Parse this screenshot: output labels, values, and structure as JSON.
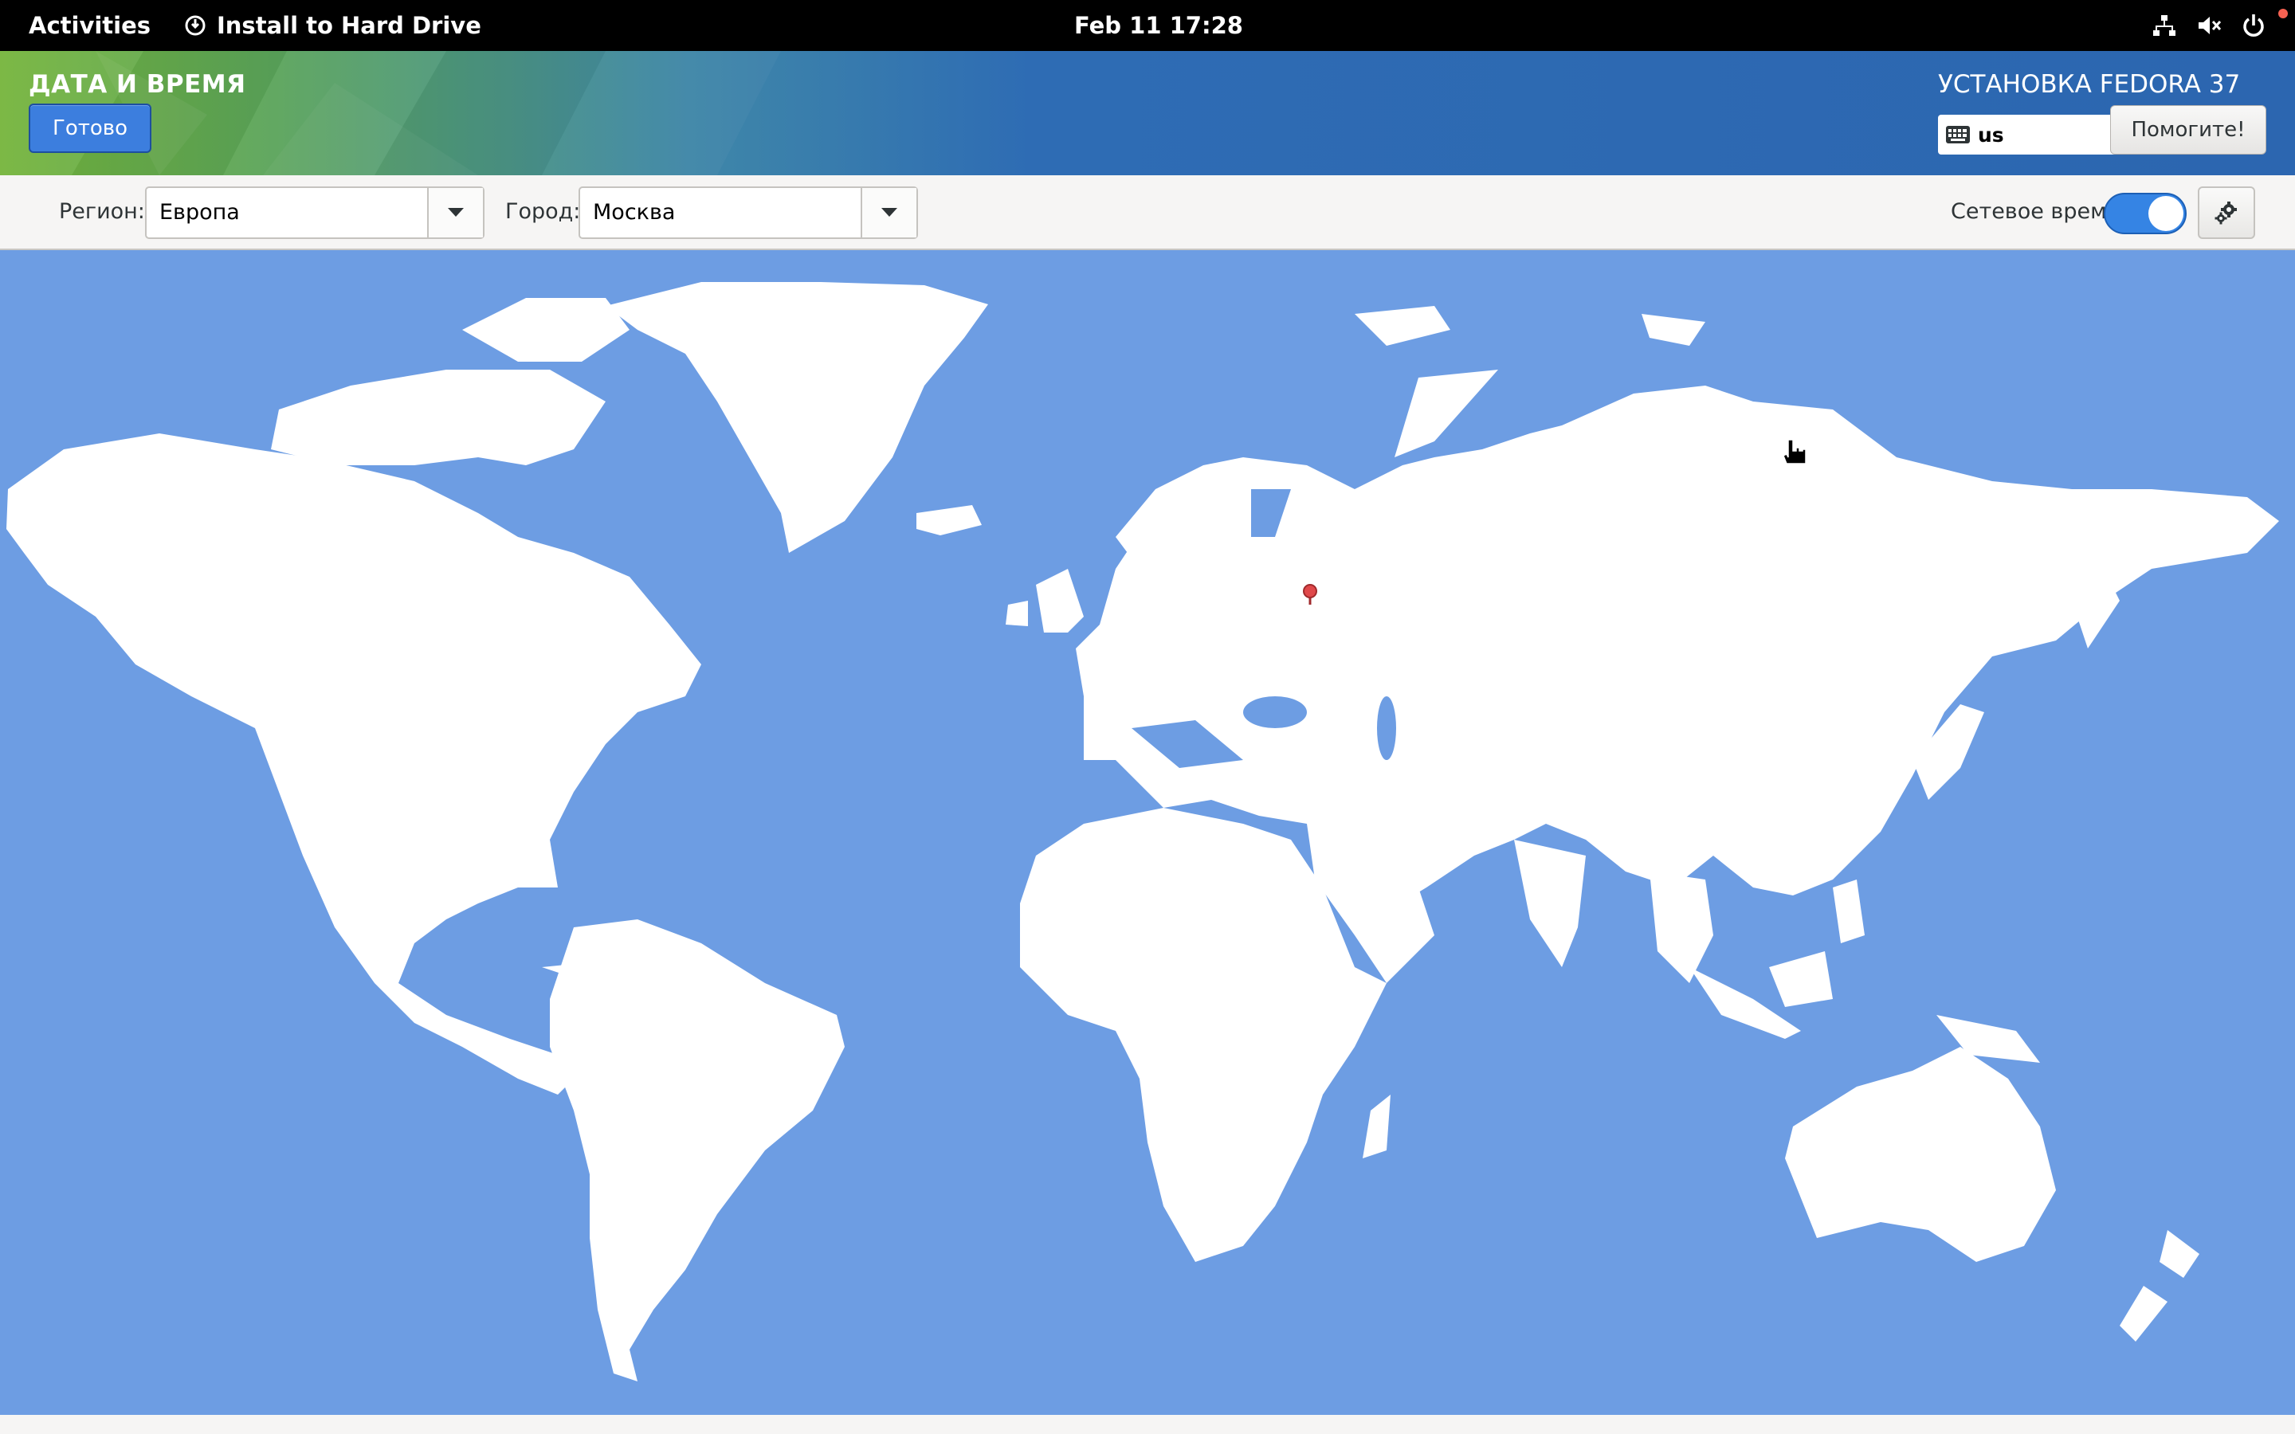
{
  "top_bar": {
    "activities_label": "Activities",
    "app_menu_label": "Install to Hard Drive",
    "clock": "Feb 11  17:28",
    "tray_icons": [
      "network-wired-icon",
      "audio-muted-icon",
      "power-icon"
    ]
  },
  "header": {
    "spoke_title": "ДАТА И ВРЕМЯ",
    "done_label": "Готово",
    "product_title": "УСТАНОВКА FEDORA 37",
    "keyboard_layout": "us",
    "help_label": "Помогите!"
  },
  "toolbar": {
    "region_label": "Регион:",
    "region_value": "Европа",
    "city_label": "Город:",
    "city_value": "Москва",
    "network_time_label": "Сетевое время",
    "network_time_enabled": true
  },
  "map": {
    "selected_city": "Москва"
  },
  "colors": {
    "ocean": "#6d9de3",
    "land": "#ffffff",
    "accent": "#3584e4",
    "marker": "#e0484a"
  }
}
